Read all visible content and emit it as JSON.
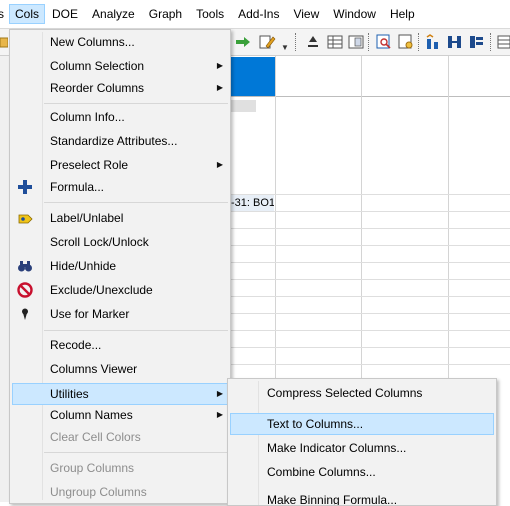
{
  "menubar": {
    "items": [
      "s",
      "Cols",
      "DOE",
      "Analyze",
      "Graph",
      "Tools",
      "Add-Ins",
      "View",
      "Window",
      "Help"
    ]
  },
  "grid": {
    "cell_text": "-31: BO1"
  },
  "cols_menu": {
    "items": [
      {
        "label": "New Columns..."
      },
      {
        "label": "Column Selection"
      },
      {
        "label": "Reorder Columns"
      },
      {
        "label": "Column Info..."
      },
      {
        "label": "Standardize Attributes..."
      },
      {
        "label": "Preselect Role"
      },
      {
        "label": "Formula..."
      },
      {
        "label": "Label/Unlabel"
      },
      {
        "label": "Scroll Lock/Unlock"
      },
      {
        "label": "Hide/Unhide"
      },
      {
        "label": "Exclude/Unexclude"
      },
      {
        "label": "Use for Marker"
      },
      {
        "label": "Recode..."
      },
      {
        "label": "Columns Viewer"
      },
      {
        "label": "Utilities"
      },
      {
        "label": "Column Names"
      },
      {
        "label": "Clear Cell Colors"
      },
      {
        "label": "Group Columns"
      },
      {
        "label": "Ungroup Columns"
      }
    ]
  },
  "utilities_submenu": {
    "items": [
      {
        "label": "Compress Selected Columns"
      },
      {
        "label": "Text to Columns..."
      },
      {
        "label": "Make Indicator Columns..."
      },
      {
        "label": "Combine Columns..."
      },
      {
        "label": "Make Binning Formula..."
      }
    ]
  },
  "colors": {
    "selection_bg": "#cce8ff",
    "selection_border": "#99d1ff",
    "selected_column": "#0078d7",
    "menu_bg": "#f2f2f2",
    "disabled_text": "#8d8d8d"
  },
  "icons": [
    "plus-icon",
    "tag-icon",
    "binoculars-icon",
    "no-entry-icon",
    "marker-pin-icon"
  ]
}
